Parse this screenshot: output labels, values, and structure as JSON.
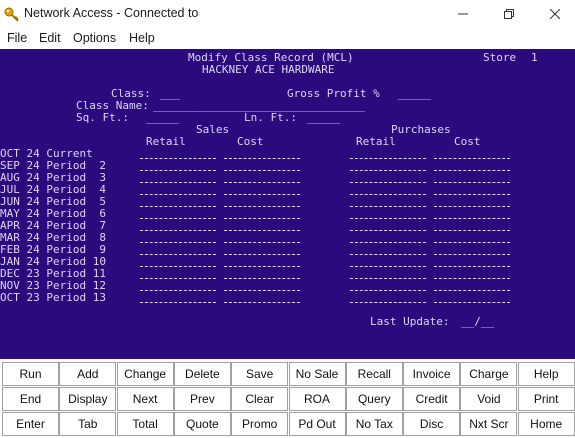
{
  "window": {
    "title": "Network Access - Connected to"
  },
  "menu": [
    "File",
    "Edit",
    "Options",
    "Help"
  ],
  "terminal": {
    "heading": "Modify Class Record (MCL)",
    "store_label": "Store",
    "store_value": "1",
    "company": "HACKNEY ACE HARDWARE",
    "class_label": "Class:",
    "class_value": "___",
    "gross_profit_label": "Gross Profit %",
    "gross_profit_value": "_____",
    "class_name_label": "Class Name:",
    "class_name_value": "________________________________",
    "sqft_label": "Sq. Ft.:",
    "sqft_value": "_____",
    "lnft_label": "Ln. Ft.:",
    "lnft_value": "_____",
    "sales_header": "Sales",
    "purchases_header": "Purchases",
    "sales_retail": "Retail",
    "sales_cost": "Cost",
    "purch_retail": "Retail",
    "purch_cost": "Cost",
    "periods": [
      "OCT 24 Current",
      "SEP 24 Period  2",
      "AUG 24 Period  3",
      "JUL 24 Period  4",
      "JUN 24 Period  5",
      "MAY 24 Period  6",
      "APR 24 Period  7",
      "MAR 24 Period  8",
      "FEB 24 Period  9",
      "JAN 24 Period 10",
      "DEC 23 Period 11",
      "NOV 23 Period 12",
      "OCT 23 Period 13"
    ],
    "last_update_label": "Last Update:",
    "last_update_value": "__/__"
  },
  "function_keys": [
    [
      "Run",
      "Add",
      "Change",
      "Delete",
      "Save",
      "No Sale",
      "Recall",
      "Invoice",
      "Charge",
      "Help"
    ],
    [
      "End",
      "Display",
      "Next",
      "Prev",
      "Clear",
      "ROA",
      "Query",
      "Credit",
      "Void",
      "Print"
    ],
    [
      "Enter",
      "Tab",
      "Total",
      "Quote",
      "Promo",
      "Pd Out",
      "No Tax",
      "Disc",
      "Nxt Scr",
      "Home"
    ]
  ]
}
